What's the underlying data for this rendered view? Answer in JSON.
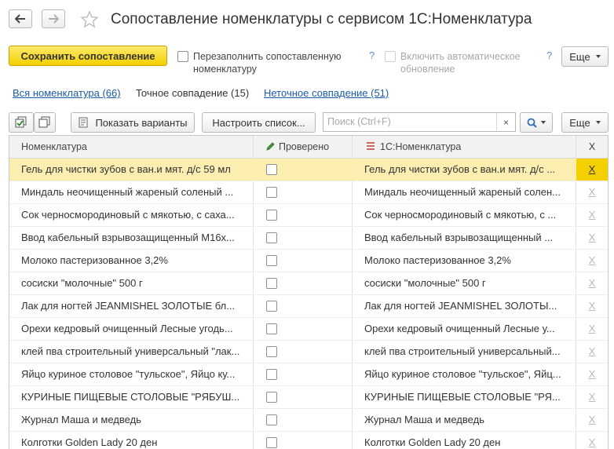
{
  "window": {
    "title": "Сопоставление номенклатуры с сервисом 1С:Номенклатура"
  },
  "actions": {
    "save_label": "Сохранить сопоставление",
    "refill_label_line1": "Перезаполнить сопоставленную",
    "refill_label_line2": "номенклатуру",
    "refill_checked": false,
    "auto_update_label_line1": "Включить автоматическое",
    "auto_update_label_line2": "обновление",
    "auto_update_checked": false,
    "auto_update_disabled": true,
    "help_glyph": "?",
    "more_label": "Еще"
  },
  "tabs": [
    {
      "label": "Вся номенклатура (66)",
      "active": false
    },
    {
      "label": "Точное совпадение (15)",
      "active": true
    },
    {
      "label": "Неточное совпадение (51)",
      "active": false
    }
  ],
  "toolbar": {
    "show_variants_label": "Показать варианты",
    "configure_list_label": "Настроить список...",
    "search_placeholder": "Поиск (Ctrl+F)",
    "clear_glyph": "×",
    "more_label": "Еще"
  },
  "table": {
    "columns": {
      "nomenclature": "Номенклатура",
      "checked": "Проверено",
      "service": "1С:Номенклатура",
      "x": "X"
    },
    "rows": [
      {
        "nomenclature": "Гель для чистки зубов с ван.и мят. д/с 59 мл",
        "checked": false,
        "service": "Гель для чистки зубов с ван.и мят. д/с ...",
        "x": "X",
        "selected": true
      },
      {
        "nomenclature": "Миндаль неочищенный жареный соленый ...",
        "checked": false,
        "service": "Миндаль неочищенный жареный солен...",
        "x": "X",
        "selected": false
      },
      {
        "nomenclature": "Сок черносмородиновый с мякотью, с саха...",
        "checked": false,
        "service": "Сок черносмородиновый с мякотью, с ...",
        "x": "X",
        "selected": false
      },
      {
        "nomenclature": "Ввод кабельный взрывозащищенный М16х...",
        "checked": false,
        "service": "Ввод кабельный взрывозащищенный ...",
        "x": "X",
        "selected": false
      },
      {
        "nomenclature": "Молоко пастеризованное 3,2%",
        "checked": false,
        "service": "Молоко пастеризованное 3,2%",
        "x": "X",
        "selected": false
      },
      {
        "nomenclature": "сосиски \"молочные\" 500 г",
        "checked": false,
        "service": "сосиски \"молочные\" 500 г",
        "x": "X",
        "selected": false
      },
      {
        "nomenclature": "Лак для ногтей JEANMISHEL ЗОЛОТЫЕ бл...",
        "checked": false,
        "service": "Лак для ногтей JEANMISHEL ЗОЛОТЫ...",
        "x": "X",
        "selected": false
      },
      {
        "nomenclature": "Орехи кедровый очищенный Лесные угодь...",
        "checked": false,
        "service": "Орехи кедровый очищенный Лесные у...",
        "x": "X",
        "selected": false
      },
      {
        "nomenclature": "клей пва строительный универсальный \"лак...",
        "checked": false,
        "service": "клей пва строительный универсальный...",
        "x": "X",
        "selected": false
      },
      {
        "nomenclature": "Яйцо куриное столовое \"тульское\", Яйцо ку...",
        "checked": false,
        "service": "Яйцо куриное столовое \"тульское\", Яйц...",
        "x": "X",
        "selected": false
      },
      {
        "nomenclature": "КУРИНЫЕ ПИЩЕВЫЕ СТОЛОВЫЕ \"РЯБУШ...",
        "checked": false,
        "service": "КУРИНЫЕ ПИЩЕВЫЕ СТОЛОВЫЕ \"РЯ...",
        "x": "X",
        "selected": false
      },
      {
        "nomenclature": "Журнал Маша и медведь",
        "checked": false,
        "service": "Журнал Маша и медведь",
        "x": "X",
        "selected": false
      },
      {
        "nomenclature": "Колготки Golden Lady 20 ден",
        "checked": false,
        "service": "Колготки Golden Lady 20 ден",
        "x": "X",
        "selected": false
      }
    ]
  },
  "colors": {
    "accent_yellow": "#f5d000",
    "selected_row": "#fbeeb0",
    "link_blue": "#1a5ca8",
    "help_blue": "#5a8fc8"
  }
}
